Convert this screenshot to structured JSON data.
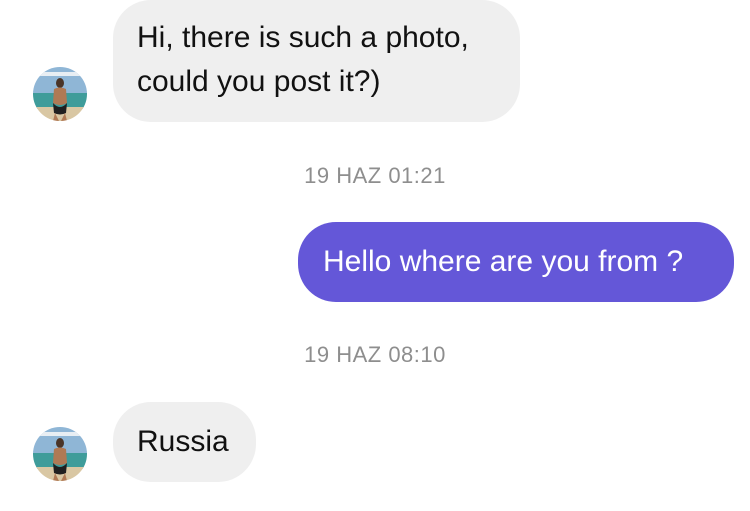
{
  "conversation": {
    "messages": [
      {
        "direction": "incoming",
        "lines": [
          "Hi, there is such a photo,",
          "could you post it?)"
        ]
      },
      {
        "direction": "outgoing",
        "text": "Hello where are you from ?"
      },
      {
        "direction": "incoming",
        "text": "Russia"
      }
    ],
    "timestamps": [
      "19 HAZ 01:21",
      "19 HAZ 08:10"
    ]
  },
  "colors": {
    "incoming_bubble": "#efefef",
    "outgoing_bubble": "#6457d8",
    "timestamp_text": "#8e8e8e"
  },
  "icons": {
    "contact_avatar": "beach-photo-avatar"
  }
}
